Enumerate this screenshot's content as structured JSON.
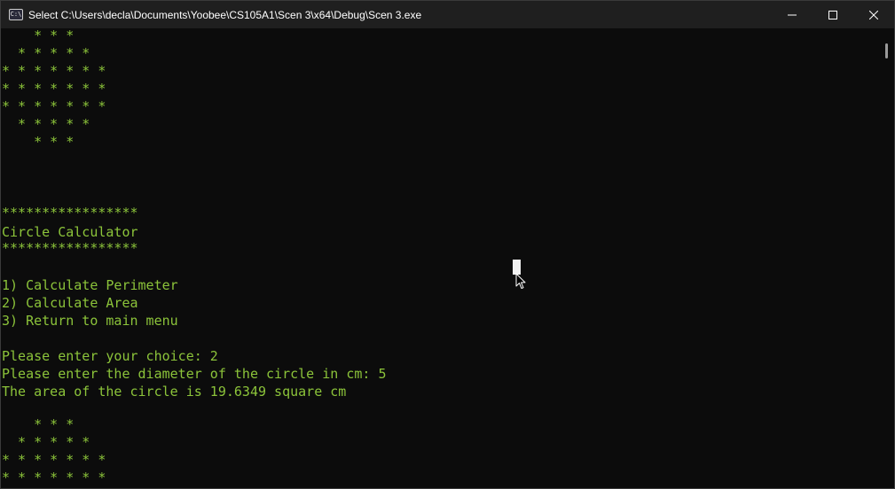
{
  "window": {
    "title": "Select C:\\Users\\decla\\Documents\\Yoobee\\CS105A1\\Scen 3\\x64\\Debug\\Scen 3.exe",
    "app_icon_label": "C:\\",
    "controls": {
      "minimize_icon": "minimize-icon",
      "maximize_icon": "maximize-icon",
      "close_icon": "close-icon"
    }
  },
  "console": {
    "text_color": "#8cc43a",
    "background": "#0c0c0c",
    "lines": [
      "    * * *",
      "  * * * * *",
      "* * * * * * *",
      "* * * * * * *",
      "* * * * * * *",
      "  * * * * *",
      "    * * *",
      "",
      "",
      "",
      "*****************",
      "Circle Calculator",
      "*****************",
      "",
      "1) Calculate Perimeter",
      "2) Calculate Area",
      "3) Return to main menu",
      "",
      "Please enter your choice: 2",
      "Please enter the diameter of the circle in cm: 5",
      "The area of the circle is 19.6349 square cm",
      "",
      "    * * *",
      "  * * * * *",
      "* * * * * * *",
      "* * * * * * *"
    ]
  }
}
